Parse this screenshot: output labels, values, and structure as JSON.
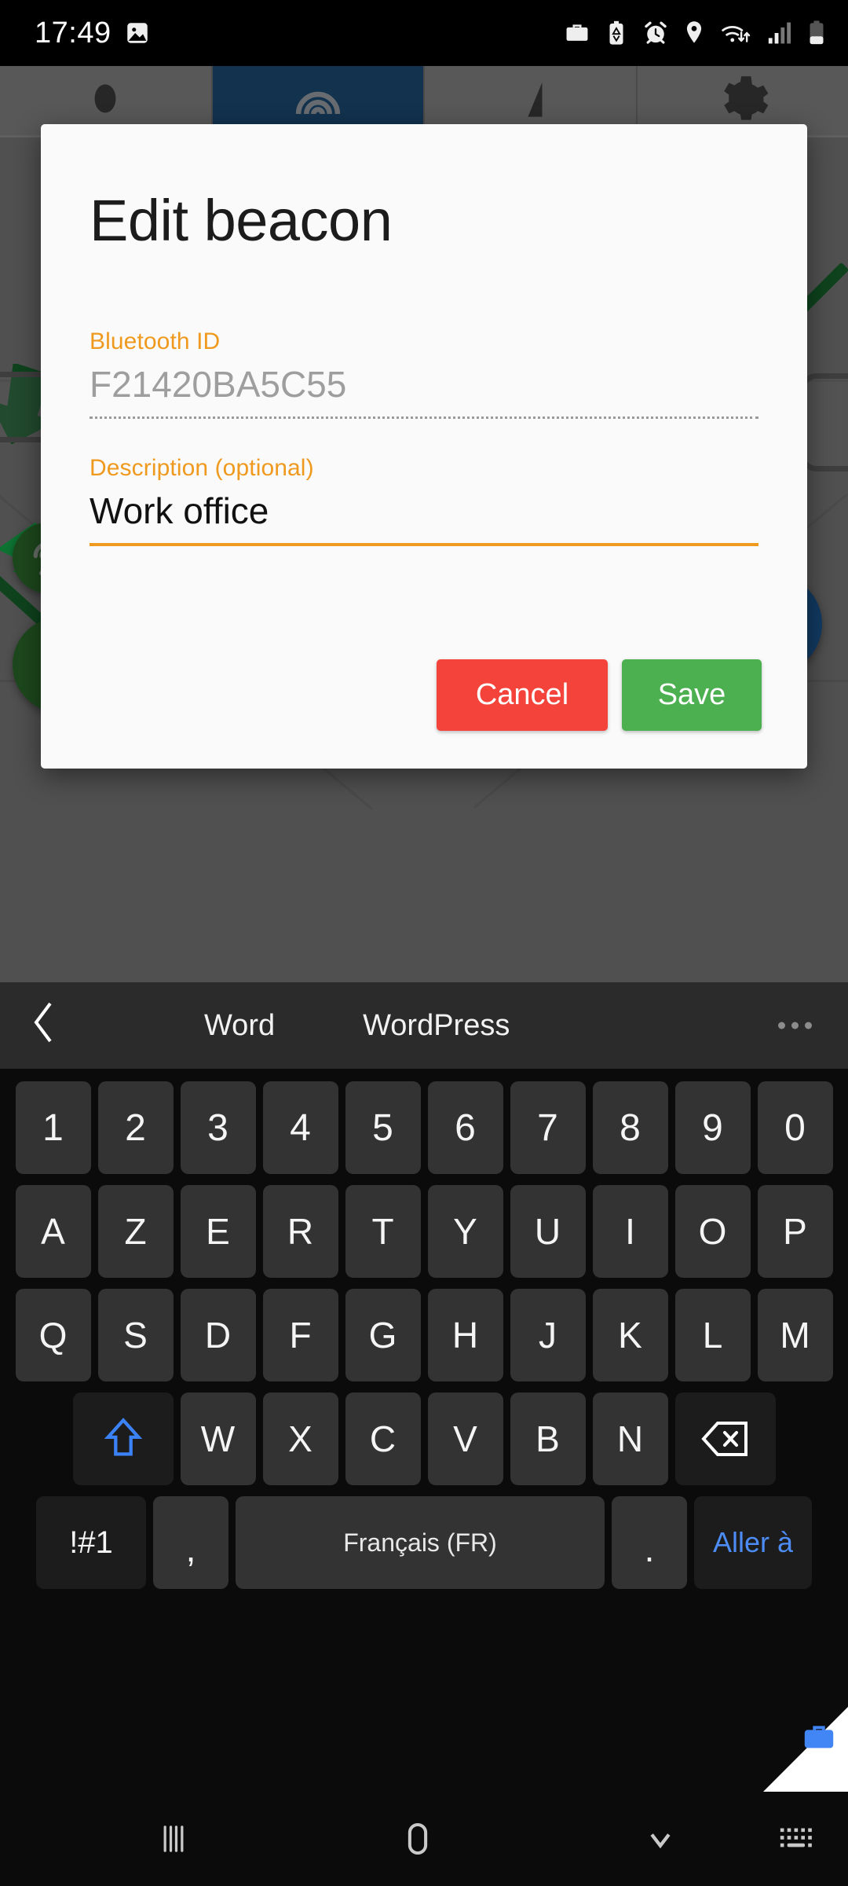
{
  "status_bar": {
    "clock": "17:49",
    "left_icons": [
      "image-icon"
    ],
    "right_icons": [
      "work-profile-briefcase-icon",
      "battery-saver-icon",
      "alarm-clock-icon",
      "location-pin-icon",
      "wifi-icon",
      "cellular-signal-icon",
      "battery-icon"
    ]
  },
  "app": {
    "tabs": [
      {
        "name": "tab-map",
        "icon": "map-marker-icon",
        "selected": false
      },
      {
        "name": "tab-beacons",
        "icon": "beacon-icon",
        "selected": true
      },
      {
        "name": "tab-signal",
        "icon": "signal-bars-icon",
        "selected": false
      },
      {
        "name": "tab-settings",
        "icon": "gear-icon",
        "selected": false
      }
    ],
    "fabs": [
      {
        "name": "beacon-fab-1",
        "icon": "beacon-antenna-icon",
        "color": "#2c6b2c"
      },
      {
        "name": "beacon-fab-2",
        "icon": "beacon-antenna-icon",
        "color": "#2c6b2c"
      },
      {
        "name": "my-location-fab",
        "icon": "crosshair-location-icon",
        "color": "#1a5691"
      }
    ]
  },
  "dialog": {
    "title": "Edit beacon",
    "bluetooth_field": {
      "label": "Bluetooth ID",
      "value": "F21420BA5C55",
      "enabled": false
    },
    "description_field": {
      "label": "Description (optional)",
      "value": "Work office",
      "placeholder": "",
      "enabled": true,
      "focused": true
    },
    "cancel_label": "Cancel",
    "save_label": "Save",
    "accent_color": "#ef9a1e",
    "cancel_color": "#f4433a",
    "save_color": "#4cb050"
  },
  "keyboard": {
    "suggestion_bar": {
      "back_icon": "chevron-left-icon",
      "suggestions": [
        "Word",
        "WordPress"
      ],
      "more_icon": "overflow-dots-icon"
    },
    "rows": {
      "numbers": [
        "1",
        "2",
        "3",
        "4",
        "5",
        "6",
        "7",
        "8",
        "9",
        "0"
      ],
      "top": [
        "A",
        "Z",
        "E",
        "R",
        "T",
        "Y",
        "U",
        "I",
        "O",
        "P"
      ],
      "home": [
        "Q",
        "S",
        "D",
        "F",
        "G",
        "H",
        "J",
        "K",
        "L",
        "M"
      ],
      "bottom_letters": [
        "W",
        "X",
        "C",
        "V",
        "B",
        "N"
      ]
    },
    "shift_icon": "shift-arrow-icon",
    "backspace_icon": "backspace-icon",
    "symbols_label": "!#1",
    "comma_label": ",",
    "space_label": "Français (FR)",
    "period_label": ".",
    "enter_label": "Aller à",
    "work_badge_icon": "briefcase-icon"
  },
  "nav_bar": {
    "recents_icon": "recents-icon",
    "home_icon": "home-icon",
    "back_icon": "chevron-down-dismiss-icon",
    "keyboard_icon": "keyboard-toggle-icon"
  }
}
